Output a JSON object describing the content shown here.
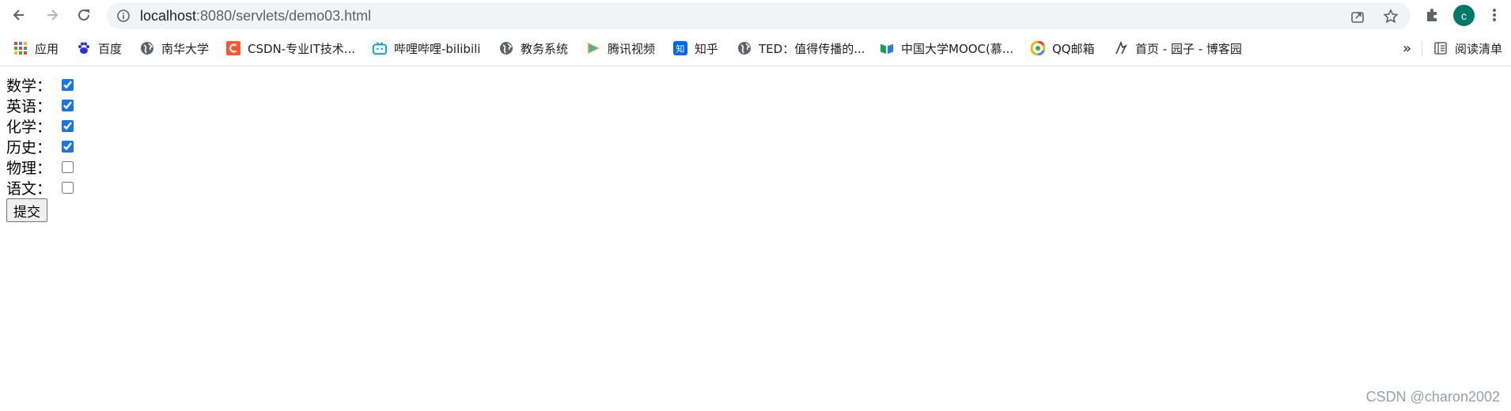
{
  "browser": {
    "url_host": "localhost",
    "url_path": ":8080/servlets/demo03.html",
    "profile_initial": "c",
    "more_bookmarks": "»",
    "reading_list_label": "阅读清单"
  },
  "bookmarks": [
    {
      "label": "应用",
      "icon": "apps-grid-icon"
    },
    {
      "label": "百度",
      "icon": "baidu-paw-icon"
    },
    {
      "label": "南华大学",
      "icon": "globe-icon"
    },
    {
      "label": "CSDN-专业IT技术...",
      "icon": "csdn-icon"
    },
    {
      "label": "哔哩哔哩-bilibili",
      "icon": "bilibili-tv-icon"
    },
    {
      "label": "教务系统",
      "icon": "globe-icon"
    },
    {
      "label": "腾讯视频",
      "icon": "tencent-video-icon"
    },
    {
      "label": "知乎",
      "icon": "zhihu-icon"
    },
    {
      "label": "TED：值得传播的...",
      "icon": "globe-icon"
    },
    {
      "label": "中国大学MOOC(慕...",
      "icon": "mooc-icon"
    },
    {
      "label": "QQ邮箱",
      "icon": "qq-mail-icon"
    },
    {
      "label": "首页 - 园子 - 博客园",
      "icon": "cnblogs-icon"
    }
  ],
  "form": {
    "subjects": [
      {
        "label": "数学：",
        "checked": true
      },
      {
        "label": "英语：",
        "checked": true
      },
      {
        "label": "化学：",
        "checked": true
      },
      {
        "label": "历史：",
        "checked": true
      },
      {
        "label": "物理：",
        "checked": false
      },
      {
        "label": "语文：",
        "checked": false
      }
    ],
    "submit_label": "提交"
  },
  "watermark": "CSDN @charon2002",
  "colors": {
    "accent": "#1a73e8",
    "avatar": "#00796b",
    "omnibox": "#f1f3f4"
  }
}
